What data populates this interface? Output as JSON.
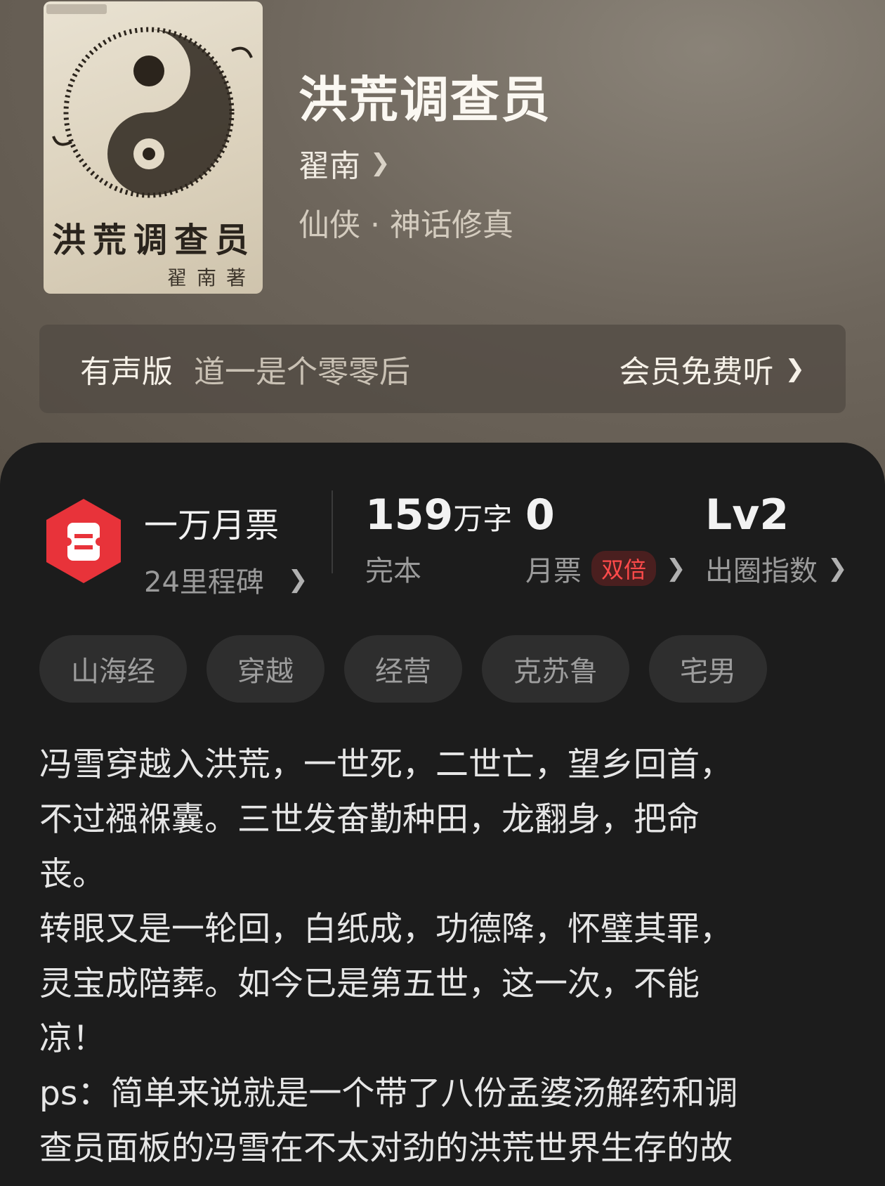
{
  "book": {
    "cover_title": "洪荒调查员",
    "cover_author": "翟南著",
    "title": "洪荒调查员",
    "author": "翟南",
    "genre": "仙侠 · 神话修真"
  },
  "audio": {
    "label": "有声版",
    "reader": "道一是个零零后",
    "cta": "会员免费听"
  },
  "stats": {
    "milestone_title": "一万月票",
    "milestone_sub": "24里程碑",
    "word_count_number": "159",
    "word_count_unit": "万字",
    "status": "完本",
    "monthly_votes": "0",
    "monthly_votes_label": "月票",
    "double_badge": "双倍",
    "influence_level": "Lv2",
    "influence_label": "出圈指数"
  },
  "tags": [
    "山海经",
    "穿越",
    "经营",
    "克苏鲁",
    "宅男"
  ],
  "description": [
    "冯雪穿越入洪荒，一世死，二世亡，望乡回首，",
    "不过襁褓囊。三世发奋勤种田，龙翻身，把命",
    "丧。",
    "转眼又是一轮回，白纸成，功德降，怀璧其罪，",
    "灵宝成陪葬。如今已是第五世，这一次，不能",
    "凉！",
    "ps：简单来说就是一个带了八份孟婆汤解药和调",
    "查员面板的冯雪在不太对劲的洪荒世界生存的故"
  ],
  "colors": {
    "panel_bg": "#1c1c1c",
    "tag_bg": "#2e2e2e",
    "accent_red": "#ff4a4a",
    "milestone_icon": "#e8333a"
  },
  "icons": {
    "milestone": "ticket-hexagon-icon",
    "chevron": "chevron-right-icon"
  }
}
